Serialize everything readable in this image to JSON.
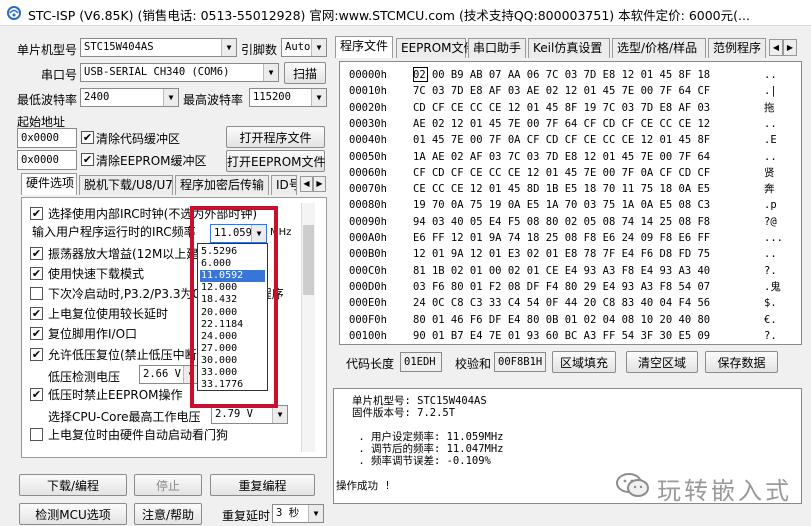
{
  "window": {
    "title": "STC-ISP (V6.85K) (销售电话: 0513-55012928) 官网:www.STCMCU.com  (技术支持QQ:800003751) 本软件定价: 6000元(..."
  },
  "left": {
    "mcu_type_label": "单片机型号",
    "mcu_type_value": "STC15W404AS",
    "pins_label": "引脚数",
    "pins_value": "Auto",
    "port_label": "串口号",
    "port_value": "USB-SERIAL CH340 (COM6)",
    "scan_button": "扫描",
    "min_baud_label": "最低波特率",
    "min_baud_value": "2400",
    "max_baud_label": "最高波特率",
    "max_baud_value": "115200",
    "start_addr_label": "起始地址",
    "addr1": "0x0000",
    "clear_code_buffer": "清除代码缓冲区",
    "open_program_button": "打开程序文件",
    "addr2": "0x0000",
    "clear_eeprom_buffer": "清除EEPROM缓冲区",
    "open_eeprom_button": "打开EEPROM文件",
    "tabs": [
      "硬件选项",
      "脱机下载/U8/U7",
      "程序加密后传输",
      "ID号"
    ],
    "options": {
      "use_irc": "选择使用内部IRC时钟(不选为外部时钟)",
      "irc_freq_label": "输入用户程序运行时的IRC频率",
      "irc_freq_value": "11.0592",
      "irc_unit": "MHz",
      "osc_gain": "振荡器放大增益(12M以上建议选择)",
      "fast_download": "使用快速下载模式",
      "next_cold_boot": "下次冷启动时,P3.2/P3.3为0/0才可下载程序",
      "reset_long_delay": "上电复位使用较长延时",
      "reset_pin_io": "复位脚用作I/O口",
      "low_volt_reset": "允许低压复位(禁止低压中断)",
      "low_volt_detect_label": "低压检测电压",
      "low_volt_detect_value": "2.66 V",
      "low_volt_no_eeprom": "低压时禁止EEPROM操作",
      "cpu_core_volt_label": "选择CPU-Core最高工作电压",
      "cpu_core_volt_value": "2.79 V",
      "watchdog_auto": "上电复位时由硬件自动启动看门狗"
    },
    "freq_options": [
      "5.5296",
      "6.000",
      "11.0592",
      "12.000",
      "18.432",
      "20.000",
      "22.1184",
      "24.000",
      "27.000",
      "30.000",
      "33.000",
      "33.1776"
    ],
    "freq_selected_index": 2,
    "download_button": "下载/编程",
    "stop_button": "停止",
    "reprogram_button": "重复编程",
    "detect_mcu_button": "检测MCU选项",
    "help_button": "注意/帮助",
    "repeat_delay_label": "重复延时",
    "repeat_delay_value": "3 秒"
  },
  "right": {
    "tabs": [
      "程序文件",
      "EEPROM文件",
      "串口助手",
      "Keil仿真设置",
      "选型/价格/样品",
      "范例程序"
    ],
    "hex_rows": [
      {
        "addr": "00000h",
        "bytes": "02 00 B9 AB 07 AA 06 7C 03 7D E8 12 01 45 8F 18",
        "ascii": ".."
      },
      {
        "addr": "00010h",
        "bytes": "7C 03 7D E8 AF 03 AE 02 12 01 45 7E 00 7F 64 CF",
        "ascii": ".|"
      },
      {
        "addr": "00020h",
        "bytes": "CD CF CE CC CE 12 01 45 8F 19 7C 03 7D E8 AF 03",
        "ascii": "拖"
      },
      {
        "addr": "00030h",
        "bytes": "AE 02 12 01 45 7E 00 7F 64 CF CD CF CE CC CE 12",
        "ascii": ".."
      },
      {
        "addr": "00040h",
        "bytes": "01 45 7E 00 7F 0A CF CD CF CE CC CE 12 01 45 8F",
        "ascii": ".E"
      },
      {
        "addr": "00050h",
        "bytes": "1A AE 02 AF 03 7C 03 7D E8 12 01 45 7E 00 7F 64",
        "ascii": ".."
      },
      {
        "addr": "00060h",
        "bytes": "CF CD CF CE CC CE 12 01 45 7E 00 7F 0A CF CD CF",
        "ascii": "贤"
      },
      {
        "addr": "00070h",
        "bytes": "CE CC CE 12 01 45 8D 1B E5 18 70 11 75 18 0A E5",
        "ascii": "奔"
      },
      {
        "addr": "00080h",
        "bytes": "19 70 0A 75 19 0A E5 1A 70 03 75 1A 0A E5 08 C3",
        "ascii": ".p"
      },
      {
        "addr": "00090h",
        "bytes": "94 03 40 05 E4 F5 08 80 02 05 08 74 14 25 08 F8",
        "ascii": "?@"
      },
      {
        "addr": "000A0h",
        "bytes": "E6 FF 12 01 9A 74 18 25 08 F8 E6 24 09 F8 E6 FF",
        "ascii": "..."
      },
      {
        "addr": "000B0h",
        "bytes": "12 01 9A 12 01 E3 02 01 E8 78 7F E4 F6 D8 FD 75",
        "ascii": ".."
      },
      {
        "addr": "000C0h",
        "bytes": "81 1B 02 01 00 02 01 CE E4 93 A3 F8 E4 93 A3 40",
        "ascii": "?."
      },
      {
        "addr": "000D0h",
        "bytes": "03 F6 80 01 F2 08 DF F4 80 29 E4 93 A3 F8 54 07",
        "ascii": ".鬼"
      },
      {
        "addr": "000E0h",
        "bytes": "24 0C C8 C3 33 C4 54 0F 44 20 C8 83 40 04 F4 56",
        "ascii": "$."
      },
      {
        "addr": "000F0h",
        "bytes": "80 01 46 F6 DF E4 80 0B 01 02 04 08 10 20 40 80",
        "ascii": "€."
      },
      {
        "addr": "00100h",
        "bytes": "90 01 B7 E4 7E 01 93 60 BC A3 FF 54 3F 30 E5 09",
        "ascii": "?."
      }
    ],
    "code_len_label": "代码长度",
    "code_len_value": "01EDH",
    "checksum_label": "校验和",
    "checksum_value": "00F8B1H",
    "fill_area_button": "区域填充",
    "clear_area_button": "清空区域",
    "save_data_button": "保存数据",
    "log_lines": [
      "单片机型号: STC15W404AS",
      "固件版本号: 7.2.5T",
      "",
      " . 用户设定频率: 11.059MHz",
      " . 调节后的频率: 11.047MHz",
      " . 频率调节误差: -0.109%",
      "",
      "操作成功 !"
    ],
    "watermark": "玩转嵌入式"
  },
  "colors": {
    "selection": "#3875d7",
    "highlight_box": "#c8102e"
  }
}
